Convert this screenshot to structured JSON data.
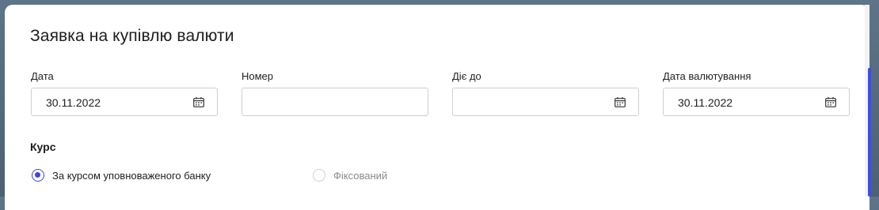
{
  "form": {
    "title": "Заявка на купівлю валюти",
    "fields": [
      {
        "label": "Дата",
        "value": "30.11.2022",
        "icon": "calendar-icon"
      },
      {
        "label": "Номер",
        "value": ""
      },
      {
        "label": "Діє до",
        "value": "",
        "icon": "calendar-icon"
      },
      {
        "label": "Дата валютування",
        "value": "30.11.2022",
        "icon": "calendar-icon"
      }
    ],
    "rate": {
      "label": "Курс",
      "options": [
        {
          "label": "За курсом уповноваженого банку",
          "selected": true
        },
        {
          "label": "Фіксований",
          "selected": false,
          "disabled": true
        }
      ]
    }
  },
  "colors": {
    "accent": "#3b47d4",
    "background": "#4d6074"
  }
}
